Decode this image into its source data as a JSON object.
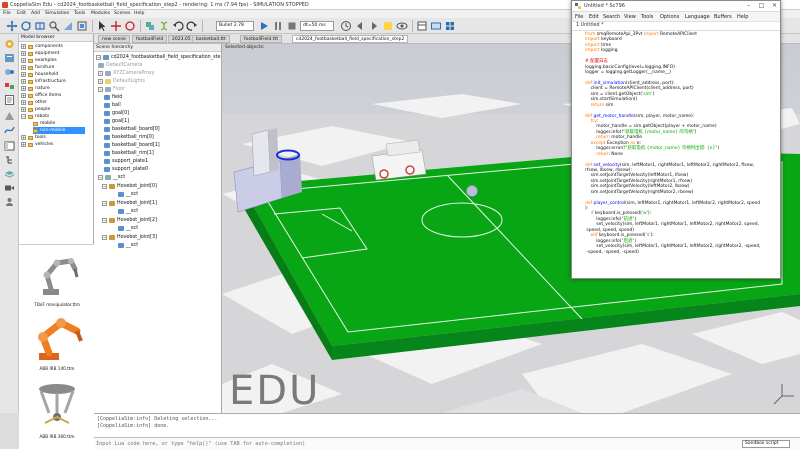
{
  "window": {
    "title": "CoppeliaSim Edu - cd2024_footbasketball_field_specification_step2 - rendering: 1 ms (7.94 fps) - SIMULATION STOPPED"
  },
  "menu": [
    "File",
    "Edit",
    "Add",
    "Simulation",
    "Tools",
    "Modules",
    "Scenes",
    "Help"
  ],
  "toolbar": {
    "engine": "Bullet 2.78",
    "sim_time": "dt=50 ms"
  },
  "model_browser": {
    "header": "Model browser",
    "folders": [
      "components",
      "equipment",
      "examples",
      "furniture",
      "household",
      "infrastructure",
      "nature",
      "office items",
      "other",
      "people",
      "robots",
      "tools",
      "vehicles"
    ],
    "subfolders": [
      "mobile",
      "non-mobile"
    ],
    "thumbnails": [
      "7DoF manipulator.ttm",
      "ABB IRB 140.ttm",
      "ABB IRB 360.ttm"
    ]
  },
  "scene_tabs": [
    "new scene",
    "footballField",
    "2023.05",
    "basketball.ttt",
    "footballField.ttt",
    "cd2024_footbasketball_field_specification_step2"
  ],
  "hierarchy": {
    "header": "Scene hierarchy",
    "root": "cd2024_footbasketball_field_specification_ste",
    "items": [
      "DefaultCamera",
      "XYZCameraProxy",
      "DefaultLights",
      "Floor",
      "field",
      "ball",
      "goal[0]",
      "goal[1]",
      "basketball_board[0]",
      "basketball_rim[0]",
      "basketball_board[1]",
      "basketball_rim[1]",
      "support_plate1",
      "support_plate0",
      "__xct"
    ],
    "robots": [
      {
        "name": "Hovebot_joint[0]",
        "child": "__xct"
      },
      {
        "name": "Hovebot_joint[1]",
        "child": "__xct"
      },
      {
        "name": "Hovebot_joint[2]",
        "child": "__xct"
      },
      {
        "name": "Hovebot_joint[3]",
        "child": "__xct"
      }
    ]
  },
  "viewport": {
    "label": "Selected objects:",
    "watermark": "EDU"
  },
  "console": {
    "lines": [
      "[CoppeliaSim:info]  Deleting selection...",
      "[CoppeliaSim:info]  done."
    ],
    "placeholder": "Input Lua code here, or type \"help()\" (use TAB for auto-completion)",
    "sandbox": "Sandbox script"
  },
  "idle": {
    "title": "Untitled",
    "title_suffix": "* Sc796",
    "menu": [
      "File",
      "Edit",
      "Search",
      "View",
      "Tools",
      "Options",
      "Language",
      "Buffers",
      "Help"
    ],
    "tab": "1 Untitled *",
    "colors": {
      "keyword": "#ff7700",
      "builtin": "#900090",
      "string": "#00aa00",
      "def_name": "#0000ff",
      "comment": "#dd0000"
    }
  },
  "code": [
    [
      [
        "kw",
        "from "
      ],
      [
        "t",
        "zmqRemoteApi_3Pvt "
      ],
      [
        "kw",
        "import "
      ],
      [
        "t",
        "RemoteAPIClient"
      ]
    ],
    [
      [
        "kw",
        "import "
      ],
      [
        "t",
        "keyboard"
      ]
    ],
    [
      [
        "kw",
        "import "
      ],
      [
        "t",
        "time"
      ]
    ],
    [
      [
        "kw",
        "import "
      ],
      [
        "t",
        "logging"
      ]
    ],
    [],
    [
      [
        "cm",
        "# 配置日志"
      ]
    ],
    [
      [
        "t",
        "logging.basicConfig(level=logging.INFO)"
      ]
    ],
    [
      [
        "t",
        "logger = logging.getLogger(__name__)"
      ]
    ],
    [],
    [
      [
        "kw",
        "def "
      ],
      [
        "df",
        "init_simulation"
      ],
      [
        "t",
        "(client_address, port):"
      ]
    ],
    [
      [
        "t",
        "    client = RemoteAPIClient(client_address, port)"
      ]
    ],
    [
      [
        "t",
        "    sim = client.getObject("
      ],
      [
        "st",
        "'sim'"
      ],
      [
        "t",
        ")"
      ]
    ],
    [
      [
        "t",
        "    sim.startSimulation()"
      ]
    ],
    [
      [
        "t",
        "    "
      ],
      [
        "kw",
        "return "
      ],
      [
        "t",
        "sim"
      ]
    ],
    [],
    [
      [
        "kw",
        "def "
      ],
      [
        "df",
        "get_motor_handle"
      ],
      [
        "t",
        "(sim, player, motor_name):"
      ]
    ],
    [
      [
        "t",
        "    "
      ],
      [
        "kw",
        "try"
      ],
      [
        "t",
        ":"
      ]
    ],
    [
      [
        "t",
        "        motor_handle = sim.getObject(player + motor_name)"
      ]
    ],
    [
      [
        "t",
        "        logger.info("
      ],
      [
        "st",
        "f\"获取电机 {motor_name} 的句柄\""
      ],
      [
        "t",
        ")"
      ]
    ],
    [
      [
        "t",
        "        "
      ],
      [
        "kw",
        "return "
      ],
      [
        "t",
        "motor_handle"
      ]
    ],
    [
      [
        "t",
        "    "
      ],
      [
        "kw",
        "except "
      ],
      [
        "t",
        "Exception "
      ],
      [
        "kw",
        "as "
      ],
      [
        "t",
        "e:"
      ]
    ],
    [
      [
        "t",
        "        logger.error("
      ],
      [
        "st",
        "f\"获取电机 {motor_name} 句柄时出错: {e}\""
      ],
      [
        "t",
        ")"
      ]
    ],
    [
      [
        "t",
        "        "
      ],
      [
        "kw",
        "return "
      ],
      [
        "t",
        "None"
      ]
    ],
    [],
    [
      [
        "kw",
        "def "
      ],
      [
        "df",
        "set_velocity"
      ],
      [
        "t",
        "(sim, leftMotor1, rightMotor1, leftMotor2, rightMotor2, flsew,"
      ]
    ],
    [
      [
        "t",
        "rfsew, lbsew, rbsew):"
      ]
    ],
    [
      [
        "t",
        "    sim.setJointTargetVelocity(leftMotor1, lfsew)"
      ]
    ],
    [
      [
        "t",
        "    sim.setJointTargetVelocity(rightMotor1, rfsew)"
      ]
    ],
    [
      [
        "t",
        "    sim.setJointTargetVelocity(leftMotor2, lbsew)"
      ]
    ],
    [
      [
        "t",
        "    sim.setJointTargetVelocity(rightMotor2, rbsew)"
      ]
    ],
    [],
    [
      [
        "kw",
        "def "
      ],
      [
        "df",
        "player_control"
      ],
      [
        "t",
        "(sim, leftMotor1, rightMotor1, leftMotor2, rightMotor2, speed"
      ]
    ],
    [
      [
        "t",
        "):"
      ]
    ],
    [
      [
        "t",
        "    "
      ],
      [
        "kw",
        "if "
      ],
      [
        "t",
        "keyboard.is_pressed("
      ],
      [
        "st",
        "'w'"
      ],
      [
        "t",
        "):"
      ]
    ],
    [
      [
        "t",
        "        logger.info("
      ],
      [
        "st",
        "\"前进\""
      ],
      [
        "t",
        ")"
      ]
    ],
    [
      [
        "t",
        "        set_velocity(sim, leftMotor1, rightMotor1, leftMotor2, rightMotor2, speed,"
      ]
    ],
    [
      [
        "t",
        " speed, speed, speed)"
      ]
    ],
    [
      [
        "t",
        "    "
      ],
      [
        "kw",
        "elif "
      ],
      [
        "t",
        "keyboard.is_pressed("
      ],
      [
        "st",
        "'s'"
      ],
      [
        "t",
        "):"
      ]
    ],
    [
      [
        "t",
        "        logger.info("
      ],
      [
        "st",
        "\"后退\""
      ],
      [
        "t",
        ")"
      ]
    ],
    [
      [
        "t",
        "        set_velocity(sim, leftMotor1, rightMotor1, leftMotor2, rightMotor2, -speed,"
      ]
    ],
    [
      [
        "t",
        " -speed, -speed, -speed)"
      ]
    ]
  ]
}
